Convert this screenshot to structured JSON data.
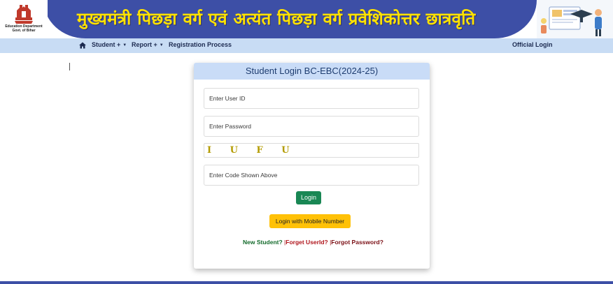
{
  "header": {
    "title": "मुख्यमंत्री पिछड़ा वर्ग एवं अत्यंत पिछड़ा वर्ग प्रवेशिकोत्तर छात्रवृति",
    "logo_line1": "Education Department",
    "logo_line2": "Govt. of Bihar",
    "brand_color": "#3d4fa6",
    "title_color": "#ffe200"
  },
  "nav": {
    "home_icon": "home-icon",
    "student": "Student +",
    "report": "Report +",
    "registration": "Registration Process",
    "official_login": "Official Login"
  },
  "login": {
    "heading": "Student Login BC-EBC(2024-25)",
    "userid_placeholder": "Enter User ID",
    "password_placeholder": "Enter Password",
    "captcha_text": "I U F U",
    "code_placeholder": "Enter Code Shown Above",
    "login_button": "Login",
    "mobile_button": "Login with Mobile Number",
    "new_student": "New Student?",
    "separator1": " |",
    "forgot_userid": "Forget UserId?",
    "separator2": " |",
    "forgot_password": "Forgot Password?"
  }
}
